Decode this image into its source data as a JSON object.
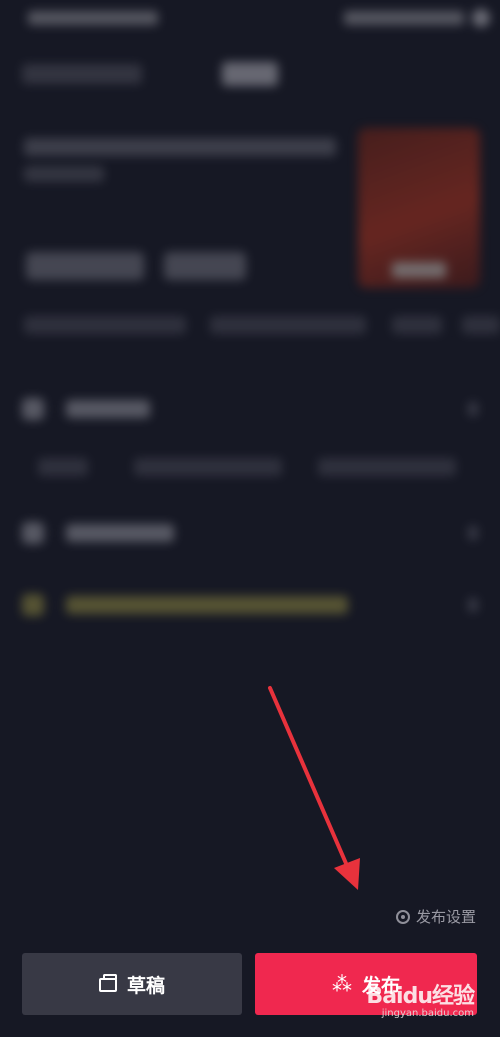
{
  "footer": {
    "publish_settings_label": "发布设置",
    "draft_label": "草稿",
    "publish_label": "发布",
    "draft_icon": "draft-box-icon",
    "publish_icon": "sparkle-icon",
    "settings_icon": "settings-circle-icon"
  },
  "watermark": {
    "brand": "Baidu经验",
    "url": "jingyan.baidu.com"
  },
  "colors": {
    "background": "#161824",
    "publish_button": "#f0284f",
    "draft_button": "#383945",
    "annotation_arrow": "#e8323c"
  }
}
